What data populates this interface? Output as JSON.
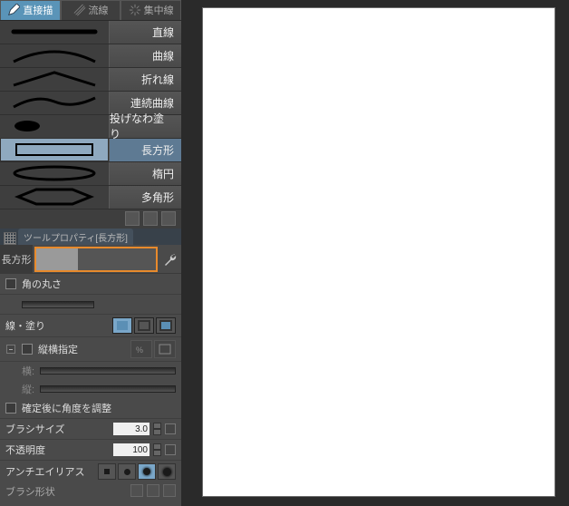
{
  "tabs": {
    "direct": "直接描",
    "flow": "流線",
    "focus": "集中線"
  },
  "subtools": {
    "line": "直線",
    "curve": "曲線",
    "poly": "折れ線",
    "spline": "連続曲線",
    "lasso": "投げなわ塗り",
    "rect": "長方形",
    "ellipse": "楕円",
    "polygon": "多角形"
  },
  "tool_property": {
    "title": "ツールプロパティ[長方形]",
    "preset_label": "長方形"
  },
  "props": {
    "corner_round": "角の丸さ",
    "line_fill": "線・塗り",
    "aspect": "縦横指定",
    "width": "横:",
    "height": "縦:",
    "rotate_after": "確定後に角度を調整",
    "brush_size": "ブラシサイズ",
    "brush_size_val": "3.0",
    "opacity": "不透明度",
    "opacity_val": "100",
    "anti_alias": "アンチエイリアス",
    "brush_shape": "ブラシ形状"
  }
}
